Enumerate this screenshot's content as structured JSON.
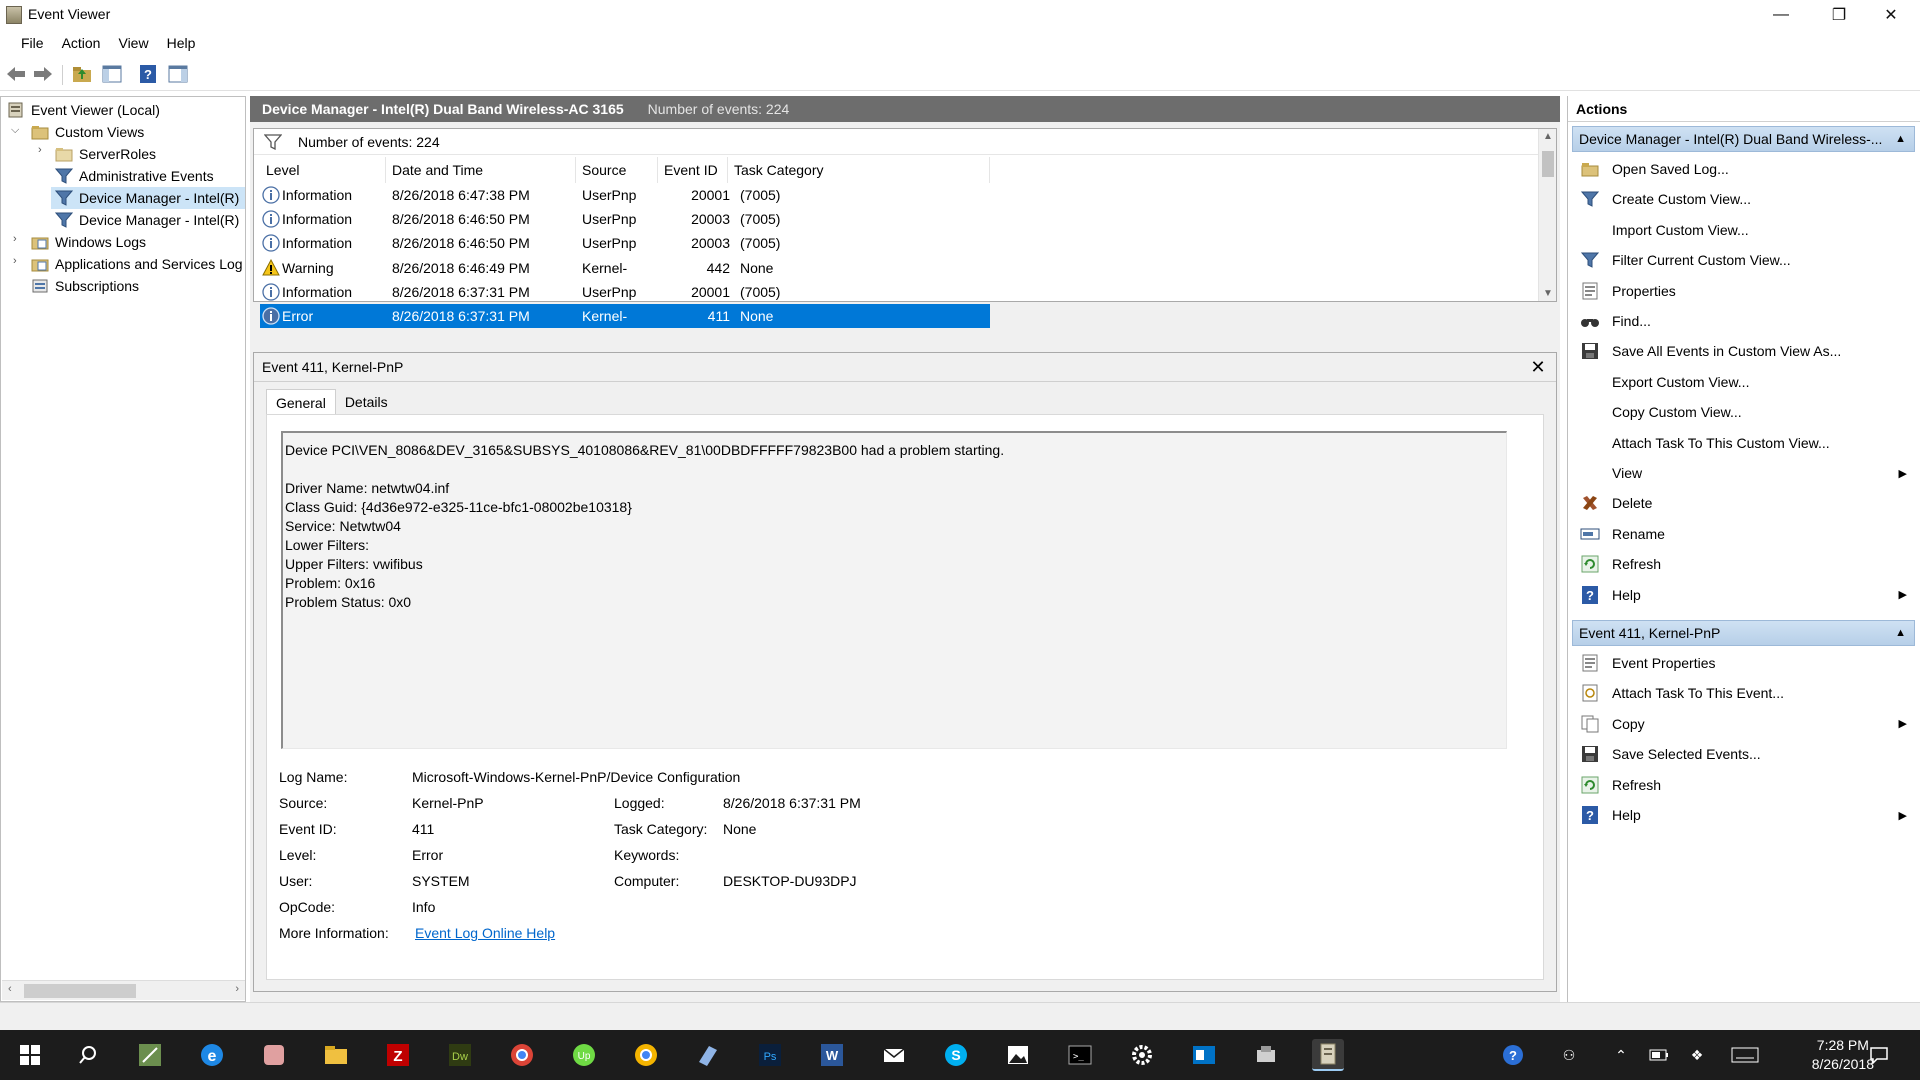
{
  "window": {
    "title": "Event Viewer",
    "minimize": "—",
    "restore": "❐",
    "close": "✕"
  },
  "menu": [
    "File",
    "Action",
    "View",
    "Help"
  ],
  "tree": {
    "root": "Event Viewer (Local)",
    "custom_views": "Custom Views",
    "server_roles": "ServerRoles",
    "admin_events": "Administrative Events",
    "dm1": "Device Manager - Intel(R)",
    "dm2": "Device Manager - Intel(R)",
    "windows_logs": "Windows Logs",
    "apps_services": "Applications and Services Log",
    "subscriptions": "Subscriptions"
  },
  "center": {
    "header_title": "Device Manager - Intel(R) Dual Band Wireless-AC 3165",
    "header_count": "Number of events: 224",
    "filter_count": "Number of events: 224",
    "columns": [
      "Level",
      "Date and Time",
      "Source",
      "Event ID",
      "Task Category"
    ],
    "rows": [
      {
        "level": "Information",
        "icon": "information-icon",
        "date": "8/26/2018 6:47:38 PM",
        "source": "UserPnp",
        "id": "20001",
        "cat": "(7005)"
      },
      {
        "level": "Information",
        "icon": "information-icon",
        "date": "8/26/2018 6:46:50 PM",
        "source": "UserPnp",
        "id": "20003",
        "cat": "(7005)"
      },
      {
        "level": "Information",
        "icon": "information-icon",
        "date": "8/26/2018 6:46:50 PM",
        "source": "UserPnp",
        "id": "20003",
        "cat": "(7005)"
      },
      {
        "level": "Warning",
        "icon": "warning-icon",
        "date": "8/26/2018 6:46:49 PM",
        "source": "Kernel-",
        "id": "442",
        "cat": "None"
      },
      {
        "level": "Information",
        "icon": "information-icon",
        "date": "8/26/2018 6:37:31 PM",
        "source": "UserPnp",
        "id": "20001",
        "cat": "(7005)"
      },
      {
        "level": "Error",
        "icon": "error-icon",
        "date": "8/26/2018 6:37:31 PM",
        "source": "Kernel-",
        "id": "411",
        "cat": "None"
      }
    ]
  },
  "detail": {
    "title": "Event 411, Kernel-PnP",
    "close": "✕",
    "tab_general": "General",
    "tab_details": "Details",
    "description": "Device PCI\\VEN_8086&DEV_3165&SUBSYS_40108086&REV_81\\00DBDFFFFF79823B00 had a problem starting.\n\nDriver Name: netwtw04.inf\nClass Guid: {4d36e972-e325-11ce-bfc1-08002be10318}\nService: Netwtw04\nLower Filters:\nUpper Filters: vwifibus\nProblem: 0x16\nProblem Status: 0x0",
    "labels": {
      "log_name": "Log Name:",
      "source": "Source:",
      "event_id": "Event ID:",
      "level": "Level:",
      "user": "User:",
      "opcode": "OpCode:",
      "more_info": "More Information:",
      "logged": "Logged:",
      "task_category": "Task Category:",
      "keywords": "Keywords:",
      "computer": "Computer:"
    },
    "values": {
      "log_name": "Microsoft-Windows-Kernel-PnP/Device Configuration",
      "source": "Kernel-PnP",
      "event_id": "411",
      "level": "Error",
      "user": "SYSTEM",
      "opcode": "Info",
      "more_info": "Event Log Online Help",
      "logged": "8/26/2018 6:37:31 PM",
      "task_category": "None",
      "keywords": "",
      "computer": "DESKTOP-DU93DPJ"
    }
  },
  "actions": {
    "title": "Actions",
    "group1": "Device Manager - Intel(R) Dual Band Wireless-...",
    "group1_items": [
      {
        "label": "Open Saved Log...",
        "icon": "open-log-icon",
        "submenu": false
      },
      {
        "label": "Create Custom View...",
        "icon": "filter-icon",
        "submenu": false
      },
      {
        "label": "Import Custom View...",
        "icon": "",
        "submenu": false
      },
      {
        "label": "Filter Current Custom View...",
        "icon": "filter-icon",
        "submenu": false
      },
      {
        "label": "Properties",
        "icon": "properties-icon",
        "submenu": false
      },
      {
        "label": "Find...",
        "icon": "find-icon",
        "submenu": false
      },
      {
        "label": "Save All Events in Custom View As...",
        "icon": "save-icon",
        "submenu": false
      },
      {
        "label": "Export Custom View...",
        "icon": "",
        "submenu": false
      },
      {
        "label": "Copy Custom View...",
        "icon": "",
        "submenu": false
      },
      {
        "label": "Attach Task To This Custom View...",
        "icon": "",
        "submenu": false
      },
      {
        "label": "View",
        "icon": "",
        "submenu": true
      },
      {
        "label": "Delete",
        "icon": "delete-icon",
        "submenu": false
      },
      {
        "label": "Rename",
        "icon": "rename-icon",
        "submenu": false
      },
      {
        "label": "Refresh",
        "icon": "refresh-icon",
        "submenu": false
      },
      {
        "label": "Help",
        "icon": "help-icon",
        "submenu": true
      }
    ],
    "group2": "Event 411, Kernel-PnP",
    "group2_items": [
      {
        "label": "Event Properties",
        "icon": "properties-icon",
        "submenu": false
      },
      {
        "label": "Attach Task To This Event...",
        "icon": "task-icon",
        "submenu": false
      },
      {
        "label": "Copy",
        "icon": "copy-icon",
        "submenu": true
      },
      {
        "label": "Save Selected Events...",
        "icon": "save-icon",
        "submenu": false
      },
      {
        "label": "Refresh",
        "icon": "refresh-icon",
        "submenu": false
      },
      {
        "label": "Help",
        "icon": "help-icon",
        "submenu": true
      }
    ]
  },
  "taskbar": {
    "time": "7:28 PM",
    "date": "8/26/2018"
  },
  "colors": {
    "selection": "#0078d7",
    "header_bg": "#6d6d6d",
    "action_group": "#c3d8ee",
    "taskbar": "#1c1c1c"
  }
}
